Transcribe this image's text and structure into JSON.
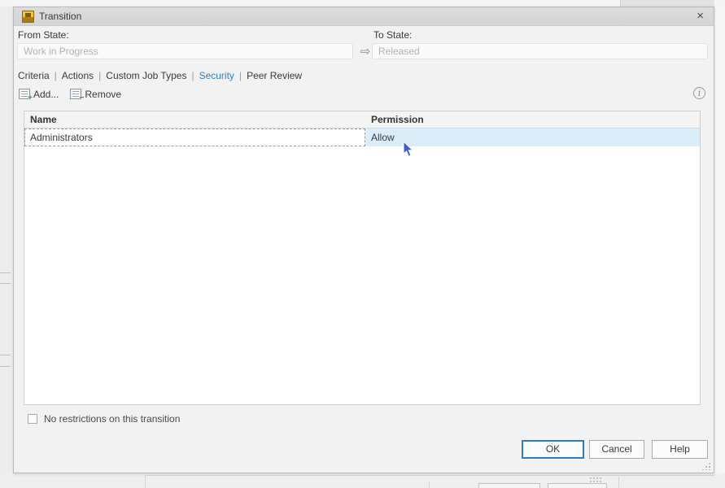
{
  "window": {
    "title": "Transition",
    "close_label": "×"
  },
  "header": {
    "from_label": "From State:",
    "from_value": "Work in Progress",
    "to_label": "To State:",
    "arrow_icon": "⇨",
    "to_value": "Released"
  },
  "tabs": {
    "separator": "|",
    "items": [
      {
        "label": "Criteria"
      },
      {
        "label": "Actions"
      },
      {
        "label": "Custom Job Types"
      },
      {
        "label": "Security",
        "active": true
      },
      {
        "label": "Peer Review"
      }
    ]
  },
  "toolbar": {
    "add_label": "Add...",
    "remove_label": "Remove",
    "add_badge": "+",
    "remove_badge": "−",
    "info_glyph": "i"
  },
  "table": {
    "columns": [
      "Name",
      "Permission"
    ],
    "rows": [
      {
        "name": "Administrators",
        "permission": "Allow"
      }
    ]
  },
  "footer": {
    "checkbox_label": "No restrictions on this transition",
    "checkbox_checked": false,
    "ok_label": "OK",
    "cancel_label": "Cancel",
    "help_label": "Help"
  },
  "colors": {
    "accent_blue": "#2d7fc1",
    "selection_blue": "#daedf8",
    "titlebar_gray": "#d9d9d9",
    "cursor_blue": "#3a5be0"
  }
}
